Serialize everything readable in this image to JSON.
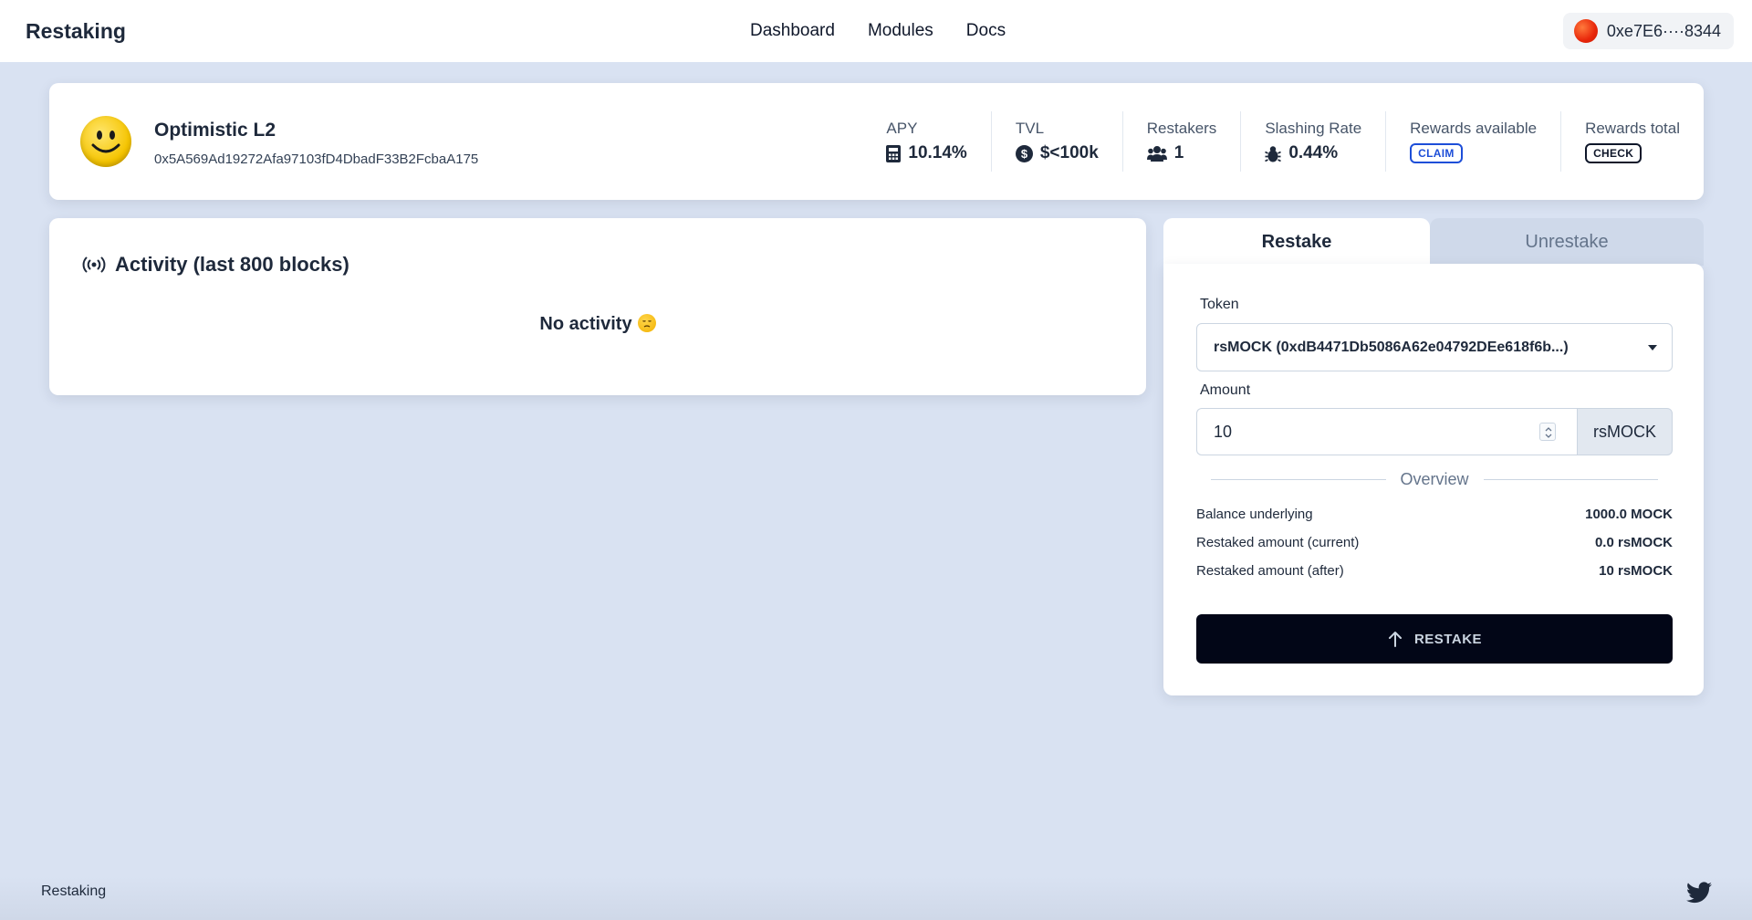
{
  "header": {
    "brand": "Restaking",
    "nav": [
      "Dashboard",
      "Modules",
      "Docs"
    ],
    "wallet_address": "0xe7E6····8344"
  },
  "module": {
    "name": "Optimistic L2",
    "address": "0x5A569Ad19272Afa97103fD4DbadF33B2FcbaA175",
    "stats": {
      "apy": {
        "label": "APY",
        "value": "10.14%"
      },
      "tvl": {
        "label": "TVL",
        "value": "$<100k"
      },
      "restakers": {
        "label": "Restakers",
        "value": "1"
      },
      "slashing": {
        "label": "Slashing Rate",
        "value": "0.44%"
      },
      "rewards_available": {
        "label": "Rewards available",
        "button": "CLAIM"
      },
      "rewards_total": {
        "label": "Rewards total",
        "button": "CHECK"
      }
    }
  },
  "activity": {
    "title": "Activity (last 800 blocks)",
    "empty_text": "No activity"
  },
  "panel": {
    "tabs": [
      "Restake",
      "Unrestake"
    ],
    "active_tab": "Restake",
    "token_label": "Token",
    "token_value": "rsMOCK (0xdB4471Db5086A62e04792DEe618f6b...)",
    "amount_label": "Amount",
    "amount_value": "10",
    "amount_unit": "rsMOCK",
    "overview_title": "Overview",
    "rows": [
      {
        "label": "Balance underlying",
        "value": "1000.0 MOCK"
      },
      {
        "label": "Restaked amount (current)",
        "value": "0.0 rsMOCK"
      },
      {
        "label": "Restaked amount (after)",
        "value": "10 rsMOCK"
      }
    ],
    "button_label": "RESTAKE"
  },
  "footer": {
    "text": "Restaking"
  },
  "icons": {
    "wallet": "wallet-avatar-icon",
    "module": "smiley-face-icon",
    "apy": "calculator-icon",
    "tvl": "dollar-circle-icon",
    "restakers": "users-icon",
    "slashing": "bug-icon",
    "activity": "broadcast-icon",
    "button": "arrow-up-icon",
    "footer": "twitter-icon"
  },
  "colors": {
    "accent": "#1d4ed8",
    "button_bg": "#020617",
    "page_bg": "#d9e2f2"
  }
}
